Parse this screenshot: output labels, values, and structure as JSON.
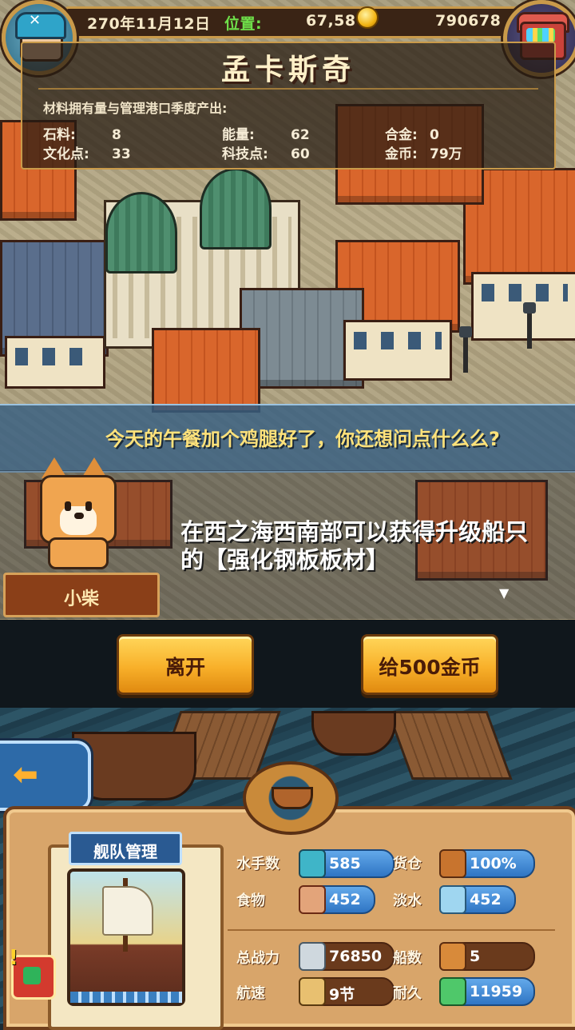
{
  "hud": {
    "date": "270年11月12日",
    "position_label": "位置:",
    "position_value": "67,58",
    "gold": "790678"
  },
  "town": {
    "name": "孟卡斯奇",
    "heading": "材料拥有量与管理港口季度产出:",
    "stats": [
      {
        "label": "石料:",
        "value": "8"
      },
      {
        "label": "能量:",
        "value": "62"
      },
      {
        "label": "合金:",
        "value": "0"
      },
      {
        "label": "文化点:",
        "value": "33"
      },
      {
        "label": "科技点:",
        "value": "60"
      },
      {
        "label": "金币:",
        "value": "79万"
      }
    ]
  },
  "dialog": {
    "banner_text": "今天的午餐加个鸡腿好了，你还想问点什么么?",
    "speech_line1": "在西之海西南部可以获得升级船只",
    "speech_line2": "的【强化钢板板材】",
    "speaker_name": "小柴",
    "more_indicator": "▼"
  },
  "buttons": {
    "leave": "离开",
    "give_gold": "给500金币",
    "back_arrow": "⬅"
  },
  "fleet": {
    "title": "舰队管理",
    "sailors_label": "水手数",
    "sailors_value": "585",
    "cargo_label": "货仓",
    "cargo_value": "100%",
    "food_label": "食物",
    "food_value": "452",
    "water_label": "淡水",
    "water_value": "452",
    "power_label": "总战力",
    "power_value": "76850",
    "ships_label": "船数",
    "ships_value": "5",
    "speed_label": "航速",
    "speed_value": "9节",
    "durability_label": "耐久",
    "durability_value": "11959",
    "alert_mark": "!"
  },
  "icons": {
    "avatar": "captain-avatar-icon",
    "chest": "treasure-chest-icon",
    "coin": "gold-coin-icon",
    "sailors": "sailor-icon",
    "cargo": "crate-icon",
    "food": "meat-icon",
    "water": "water-jug-icon",
    "power": "crossed-swords-icon",
    "ships": "ship-icon",
    "speed": "sail-icon",
    "durability": "repair-icon"
  },
  "colors": {
    "gold_button": "#f8b02a",
    "banner_text": "#ffe27a",
    "fleet_blue": "#2f75c4"
  }
}
